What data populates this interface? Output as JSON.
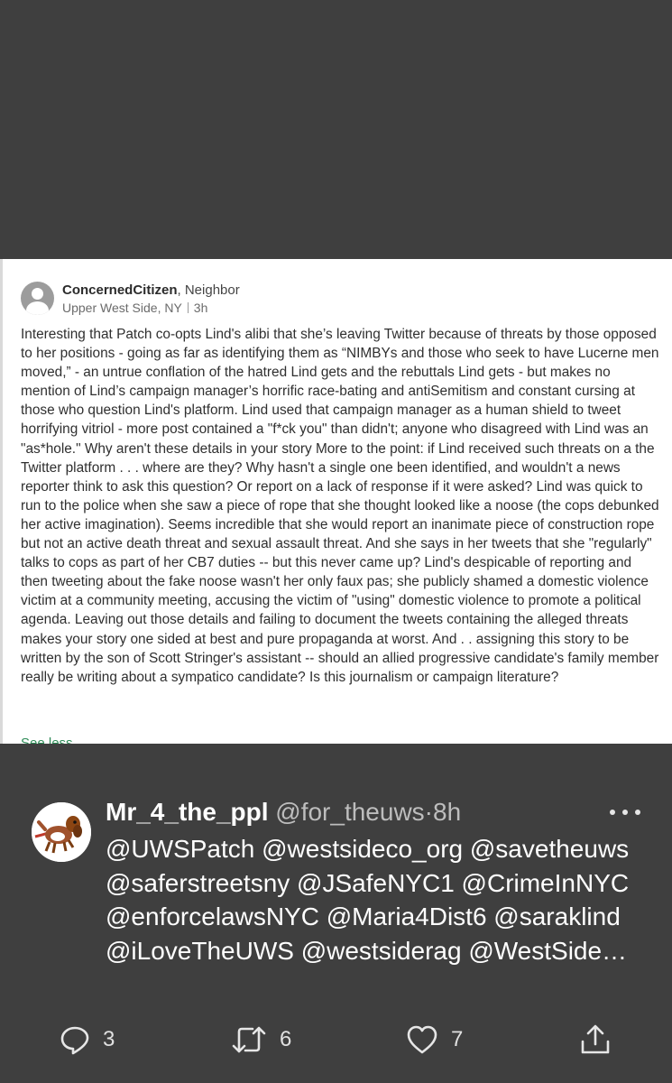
{
  "comment": {
    "author": "ConcernedCitizen",
    "author_suffix": ", Neighbor",
    "location": "Upper West Side, NY",
    "time": "3h",
    "body": "Interesting that Patch co-opts Lind's alibi that she’s leaving Twitter because of threats by those opposed to her positions - going as far as identifying them as “NIMBYs and those who seek to have Lucerne men moved,” - an untrue conflation of the hatred Lind gets and the rebuttals Lind gets - but makes no mention of Lind’s campaign manager’s horrific race-bating and antiSemitism and constant cursing at those who question Lind's platform. Lind used that campaign manager as a human shield to tweet horrifying vitriol - more post contained a \"f*ck you\" than didn't; anyone who disagreed with Lind was an \"as*hole.\" Why aren't these details in your story More to the point: if Lind received such threats on a the Twitter platform . . . where are they? Why hasn't a single one been identified, and wouldn't a news reporter think to ask this question? Or report on a lack of response if it were asked? Lind was quick to run to the police when she saw a piece of rope that she thought looked like a noose (the cops debunked her active imagination). Seems incredible that she would report an inanimate piece of construction rope but not an active death threat and sexual assault threat. And she says in her tweets that she \"regularly\" talks to cops as part of her CB7 duties -- but this never came up? Lind's despicable of reporting and then tweeting about the fake noose wasn't her only faux pas; she publicly shamed a domestic violence victim at a community meeting, accusing the victim of \"using\" domestic violence to promote a political agenda. Leaving out those details and failing to document the tweets containing the alleged threats makes your story one sided at best and pure propaganda at worst. And . . assigning this story to be written by the son of Scott Stringer's assistant -- should an allied progressive candidate's family member really be writing about a sympatico candidate? Is this journalism or campaign literature?",
    "see_less": "See less"
  },
  "tweet": {
    "display_name": "Mr_4_the_ppl",
    "handle": "@for_theuws",
    "sep": "·",
    "time": "8h",
    "text": "@UWSPatch @westsideco_org @savetheuws @saferstreetsny @JSafeNYC1 @CrimeInNYC @enforcelawsNYC @Maria4Dist6 @saraklind @iLoveTheUWS @westsiderag @WestSide…",
    "replies": "3",
    "retweets": "6",
    "likes": "7"
  },
  "colors": {
    "background_dark": "#3f3f3f",
    "link_green": "#2e8b57",
    "card_white": "#ffffff"
  },
  "icons": [
    "user-placeholder-icon",
    "more-icon",
    "reply-icon",
    "retweet-icon",
    "like-icon",
    "share-icon"
  ]
}
